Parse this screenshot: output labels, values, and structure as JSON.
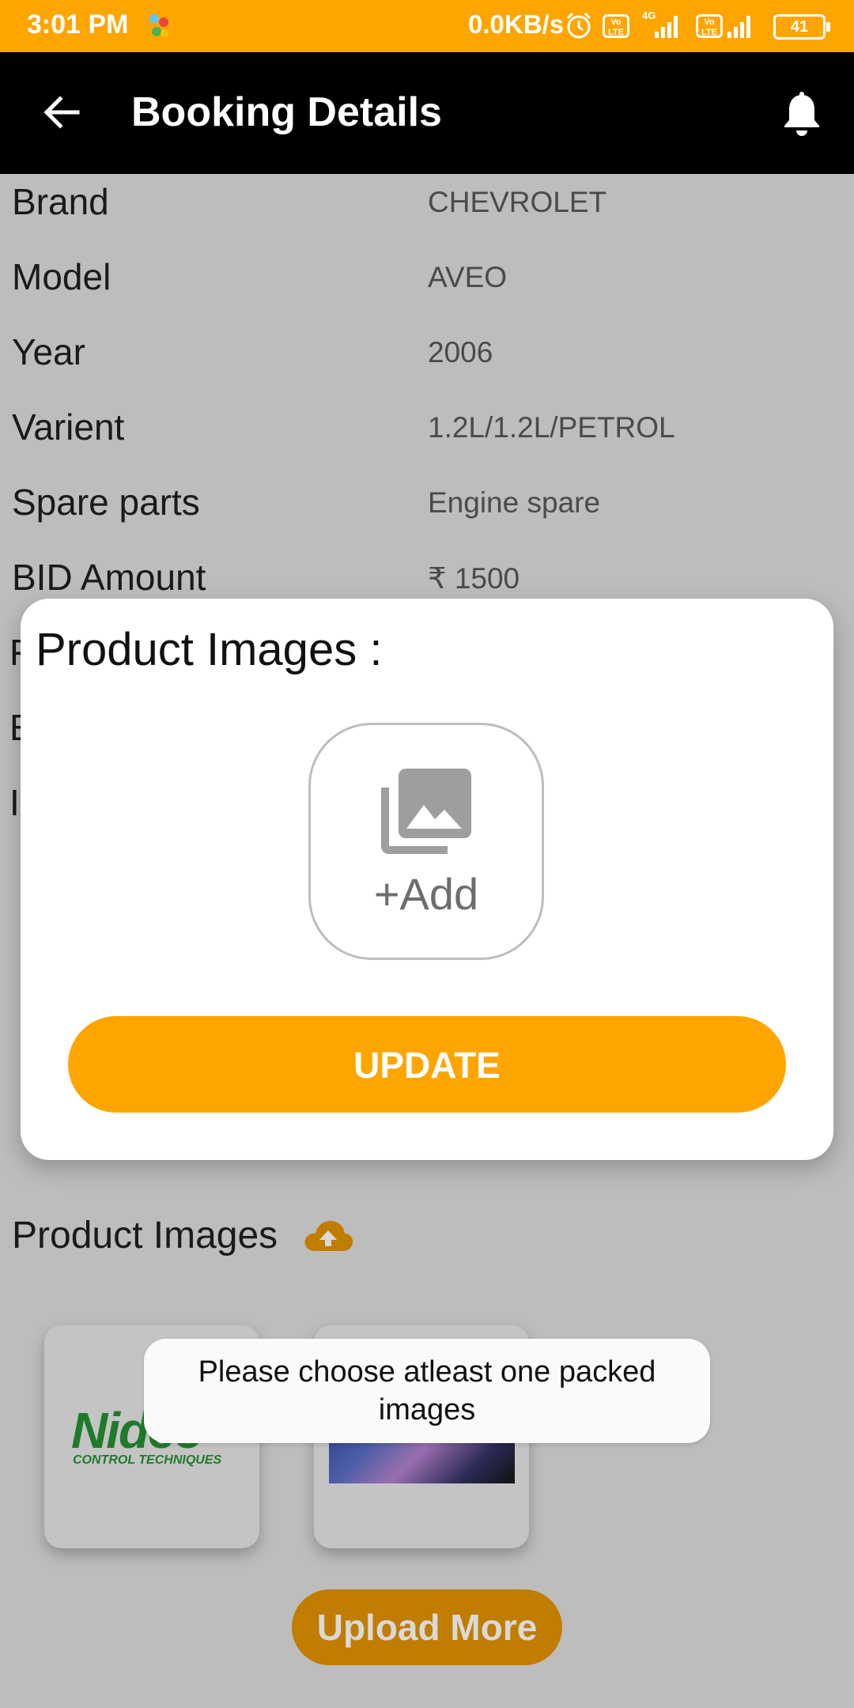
{
  "status_bar": {
    "time": "3:01 PM",
    "network_speed": "0.0KB/s",
    "volte_label": "Vo LTE",
    "network_type": "4G",
    "battery": "41"
  },
  "app_bar": {
    "title": "Booking Details",
    "back_icon": "arrow-back-icon",
    "notification_icon": "bell-icon"
  },
  "details": [
    {
      "label": "Brand",
      "value": "CHEVROLET"
    },
    {
      "label": "Model",
      "value": "AVEO"
    },
    {
      "label": "Year",
      "value": "2006"
    },
    {
      "label": "Varient",
      "value": "1.2L/1.2L/PETROL"
    },
    {
      "label": "Spare parts",
      "value": "Engine spare"
    },
    {
      "label": "BID Amount",
      "value": "₹ 1500"
    }
  ],
  "peek_letters": [
    "F",
    "E",
    "I"
  ],
  "product_images": {
    "title": "Product Images",
    "upload_icon": "cloud-upload-icon",
    "logo_text": "Nidec",
    "logo_subtext": "CONTROL TECHNIQUES",
    "upload_more_label": "Upload More"
  },
  "dialog": {
    "title": "Product Images :",
    "add_icon": "photo-library-icon",
    "add_label": "+Add",
    "update_label": "UPDATE"
  },
  "toast": {
    "message": "Please choose atleast one packed images"
  },
  "colors": {
    "accent": "#ffa500",
    "appbar": "#000000",
    "scrim_background": "#bdbdbd"
  }
}
